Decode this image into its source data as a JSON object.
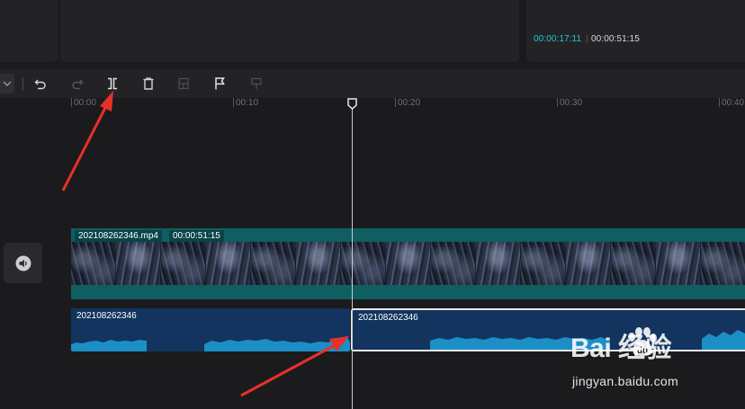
{
  "preview": {
    "current_time": "00:00:17:11",
    "total_time": "00:00:51:15"
  },
  "toolbar": {
    "tools": [
      {
        "name": "undo-icon",
        "enabled": true
      },
      {
        "name": "redo-icon",
        "enabled": false
      },
      {
        "name": "split-icon",
        "enabled": true
      },
      {
        "name": "delete-icon",
        "enabled": true
      },
      {
        "name": "freeze-icon",
        "enabled": false
      },
      {
        "name": "marker-icon",
        "enabled": true
      },
      {
        "name": "marker-disabled-icon",
        "enabled": false
      }
    ]
  },
  "ruler": {
    "labels": [
      "00:00",
      "00:10",
      "00:20",
      "00:30",
      "00:40"
    ]
  },
  "video_track": {
    "file_name": "202108262346.mp4",
    "duration": "00:00:51:15"
  },
  "audio_track": {
    "clips": [
      {
        "label": "202108262346"
      },
      {
        "label": "202108262346",
        "selected": true
      }
    ]
  },
  "watermark": {
    "logo": "Bai  经验",
    "url": "jingyan.baidu.com"
  },
  "colors": {
    "background": "#1b1b1e",
    "panel": "#232326",
    "accent_timecode": "#26c4d4",
    "video_track": "#0f5e61",
    "audio_clip": "#13345e",
    "waveform": "#1c8fc6",
    "annotation_arrow": "#e8302a"
  }
}
